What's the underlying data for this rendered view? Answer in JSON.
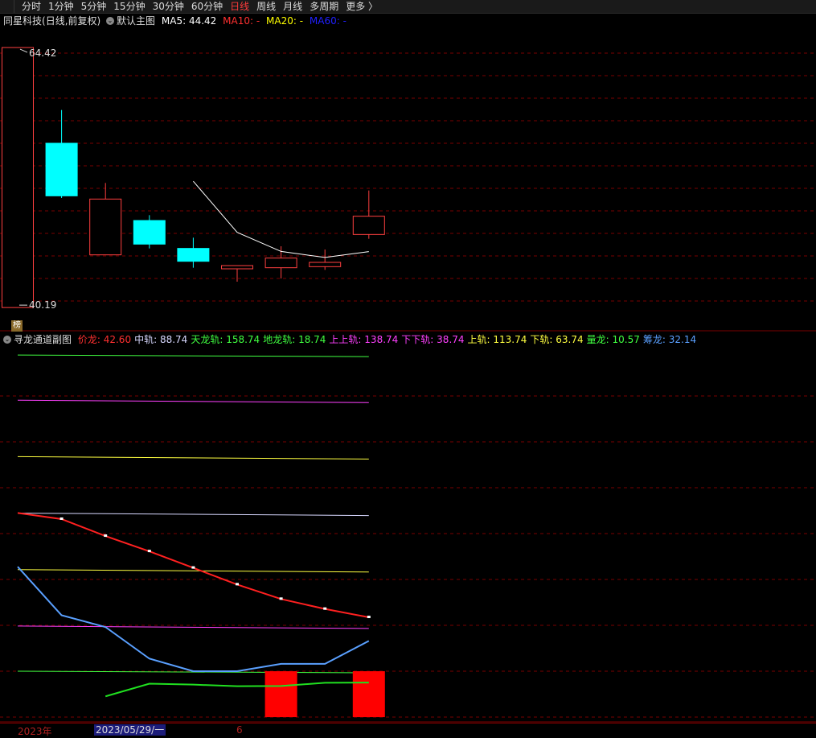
{
  "tabs": {
    "items": [
      "分时",
      "1分钟",
      "5分钟",
      "15分钟",
      "30分钟",
      "60分钟",
      "日线",
      "周线",
      "月线",
      "多周期",
      "更多 〉"
    ],
    "active": "日线"
  },
  "main": {
    "stock_name": "同星科技",
    "period": "(日线,前复权)",
    "indicator": "默认主图",
    "ma5_label": "MA5:",
    "ma5_value": "44.42",
    "ma10_label": "MA10:",
    "ma10_value": "-",
    "ma20_label": "MA20:",
    "ma20_value": "-",
    "ma60_label": "MA60:",
    "ma60_value": "-",
    "high_label": "64.42",
    "low_label": "40.19"
  },
  "sub": {
    "title": "寻龙通道副图",
    "items": [
      {
        "label": "价龙:",
        "value": "42.60",
        "color": "#ff3030"
      },
      {
        "label": "中轨:",
        "value": "88.74",
        "color": "#d8d8ff"
      },
      {
        "label": "天龙轨:",
        "value": "158.74",
        "color": "#40ff40"
      },
      {
        "label": "地龙轨:",
        "value": "18.74",
        "color": "#40ff40"
      },
      {
        "label": "上上轨:",
        "value": "138.74",
        "color": "#ff40ff"
      },
      {
        "label": "下下轨:",
        "value": "38.74",
        "color": "#ff40ff"
      },
      {
        "label": "上轨:",
        "value": "113.74",
        "color": "#ffff40"
      },
      {
        "label": "下轨:",
        "value": "63.74",
        "color": "#ffff40"
      },
      {
        "label": "量龙:",
        "value": "10.57",
        "color": "#40ff40"
      },
      {
        "label": "筹龙:",
        "value": "32.14",
        "color": "#5aa0ff"
      }
    ]
  },
  "bottom": {
    "year": "2023年",
    "date": "2023/05/29/一",
    "month": "6"
  },
  "badge": "榜",
  "colors": {
    "up": "#ff4040",
    "down": "#00ffff",
    "ma5": "#ffffff",
    "ma10": "#ff3030",
    "ma20": "#ffff00",
    "ma60": "#2020ff",
    "grid": "#7a0000"
  },
  "chart_data": {
    "type": "candlestick",
    "candles": [
      {
        "open": 40.19,
        "close": 64.42,
        "high": 64.42,
        "low": 40.19
      },
      {
        "open": 55.5,
        "close": 50.6,
        "high": 58.6,
        "low": 50.4
      },
      {
        "open": 45.1,
        "close": 50.3,
        "high": 51.8,
        "low": 45.1
      },
      {
        "open": 48.3,
        "close": 46.1,
        "high": 48.8,
        "low": 45.7
      },
      {
        "open": 45.7,
        "close": 44.5,
        "high": 46.7,
        "low": 43.9
      },
      {
        "open": 43.8,
        "close": 44.1,
        "high": 44.1,
        "low": 42.6
      },
      {
        "open": 43.9,
        "close": 44.8,
        "high": 45.9,
        "low": 42.9
      },
      {
        "open": 44.0,
        "close": 44.4,
        "high": 45.6,
        "low": 43.7
      },
      {
        "open": 47.0,
        "close": 48.7,
        "high": 51.1,
        "low": 46.6
      }
    ],
    "ma5": [
      null,
      null,
      null,
      null,
      51.96,
      47.2,
      45.42,
      44.86,
      45.4
    ],
    "ma5_start_index": 4,
    "price_range": [
      39.0,
      66.0
    ],
    "sub": {
      "middle": 88.74,
      "upper_upper": 138.74,
      "lower_lower": 38.74,
      "upper": 113.74,
      "lower": 63.74,
      "sky_rail": 158.74,
      "ground_rail": 18.74,
      "price_dragon": [
        88.8,
        86.1,
        78.6,
        71.8,
        64.5,
        57.1,
        50.7,
        46.3,
        42.6
      ],
      "chip_dragon": [
        65.0,
        43.5,
        38.3,
        24.3,
        18.74,
        18.74,
        22.0,
        22.0,
        32.14
      ],
      "volume_dragon": [
        null,
        null,
        null,
        7.6,
        13.2,
        12.8,
        12.1,
        12.2,
        13.6,
        13.7
      ],
      "volume_bars": [
        {
          "index": 6,
          "from": 18.74,
          "to": -1.6
        },
        {
          "index": 8,
          "from": 18.74,
          "to": -1.6
        }
      ],
      "range": [
        -3,
        162
      ]
    }
  }
}
